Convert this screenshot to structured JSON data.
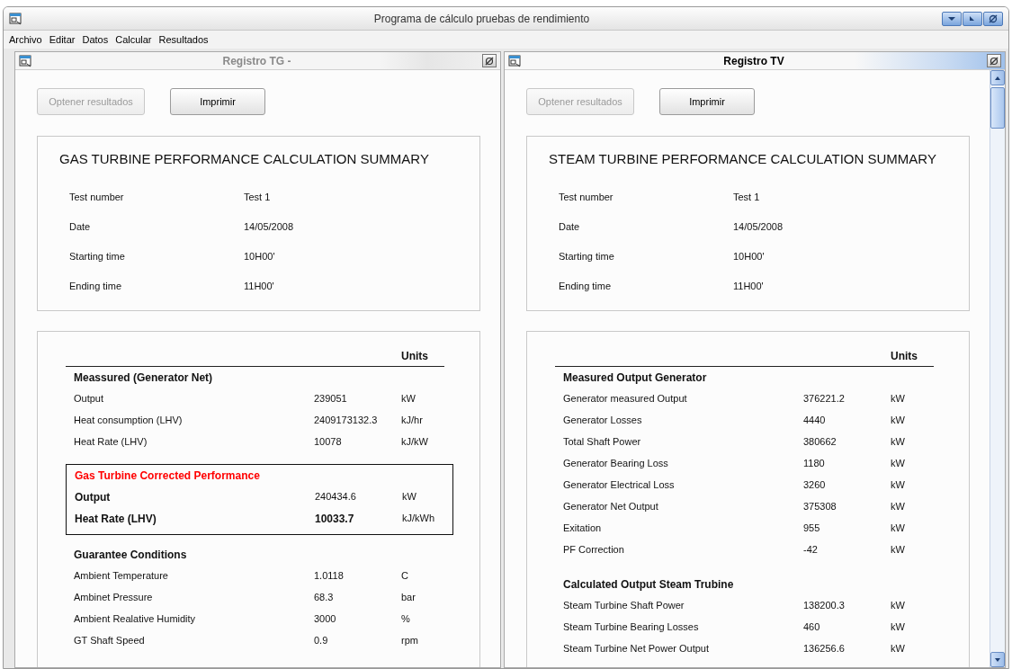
{
  "window": {
    "title": "Programa de cálculo pruebas de rendimiento"
  },
  "menu": [
    "Archivo",
    "Editar",
    "Datos",
    "Calcular",
    "Resultados"
  ],
  "panels": [
    {
      "title": "Registro TG -",
      "active": false,
      "has_scrollbar": false,
      "buttons": [
        {
          "label": "Optener resultados",
          "disabled": true
        },
        {
          "label": "Imprimir",
          "disabled": false
        }
      ],
      "summary": {
        "heading": "GAS TURBINE PERFORMANCE CALCULATION SUMMARY",
        "fields": [
          {
            "label": "Test number",
            "value": "Test 1"
          },
          {
            "label": "Date",
            "value": "14/05/2008"
          },
          {
            "label": "Starting time",
            "value": "10H00'"
          },
          {
            "label": "Ending time",
            "value": "11H00'"
          }
        ]
      },
      "results": {
        "units_header": "Units",
        "sections": [
          {
            "kind": "plain",
            "heading": "Meassured (Generator Net)",
            "rows": [
              {
                "label": "Output",
                "value": "239051",
                "unit": "kW"
              },
              {
                "label": "Heat consumption (LHV)",
                "value": "2409173132.3",
                "unit": "kJ/hr"
              },
              {
                "label": "Heat Rate (LHV)",
                "value": "10078",
                "unit": "kJ/kW"
              }
            ]
          },
          {
            "kind": "boxed",
            "heading": "Gas Turbine Corrected Performance",
            "rows": [
              {
                "label": "Output",
                "value": "240434.6",
                "unit": "kW",
                "bold_label": true,
                "bold_value": false
              },
              {
                "label": "Heat Rate (LHV)",
                "value": "10033.7",
                "unit": "kJ/kWh",
                "bold_label": true,
                "bold_value": true
              }
            ]
          },
          {
            "kind": "plain",
            "heading": "Guarantee Conditions",
            "rows": [
              {
                "label": "Ambient Temperature",
                "value": "1.0118",
                "unit": "C"
              },
              {
                "label": "Ambinet Pressure",
                "value": "68.3",
                "unit": "bar"
              },
              {
                "label": "Ambient Realative Humidity",
                "value": "3000",
                "unit": "%"
              },
              {
                "label": "GT Shaft Speed",
                "value": "0.9",
                "unit": "rpm"
              }
            ]
          }
        ]
      }
    },
    {
      "title": "Registro TV",
      "active": true,
      "has_scrollbar": true,
      "buttons": [
        {
          "label": "Optener resultados",
          "disabled": true
        },
        {
          "label": "Imprimir",
          "disabled": false
        }
      ],
      "summary": {
        "heading": "STEAM TURBINE PERFORMANCE CALCULATION SUMMARY",
        "fields": [
          {
            "label": "Test number",
            "value": "Test 1"
          },
          {
            "label": "Date",
            "value": "14/05/2008"
          },
          {
            "label": "Starting time",
            "value": "10H00'"
          },
          {
            "label": "Ending time",
            "value": "11H00'"
          }
        ]
      },
      "results": {
        "units_header": "Units",
        "sections": [
          {
            "kind": "plain",
            "heading": "Measured Output Generator",
            "rows": [
              {
                "label": "Generator measured Output",
                "value": "376221.2",
                "unit": "kW"
              },
              {
                "label": "Generator Losses",
                "value": "4440",
                "unit": "kW"
              },
              {
                "label": "Total Shaft Power",
                "value": "380662",
                "unit": "kW"
              },
              {
                "label": "Generator Bearing Loss",
                "value": "1180",
                "unit": "kW"
              },
              {
                "label": "Generator Electrical Loss",
                "value": "3260",
                "unit": "kW"
              },
              {
                "label": "Generator Net Output",
                "value": "375308",
                "unit": "kW"
              },
              {
                "label": "Exitation",
                "value": "955",
                "unit": "kW"
              },
              {
                "label": "PF Correction",
                "value": "-42",
                "unit": "kW"
              }
            ]
          },
          {
            "kind": "plain",
            "heading": "Calculated Output Steam Trubine",
            "rows": [
              {
                "label": "Steam Turbine Shaft Power",
                "value": "138200.3",
                "unit": "kW"
              },
              {
                "label": "Steam Turbine Bearing Losses",
                "value": "460",
                "unit": "kW"
              },
              {
                "label": "Steam Turbine Net Power Output",
                "value": "136256.6",
                "unit": "kW"
              }
            ]
          }
        ]
      }
    }
  ]
}
